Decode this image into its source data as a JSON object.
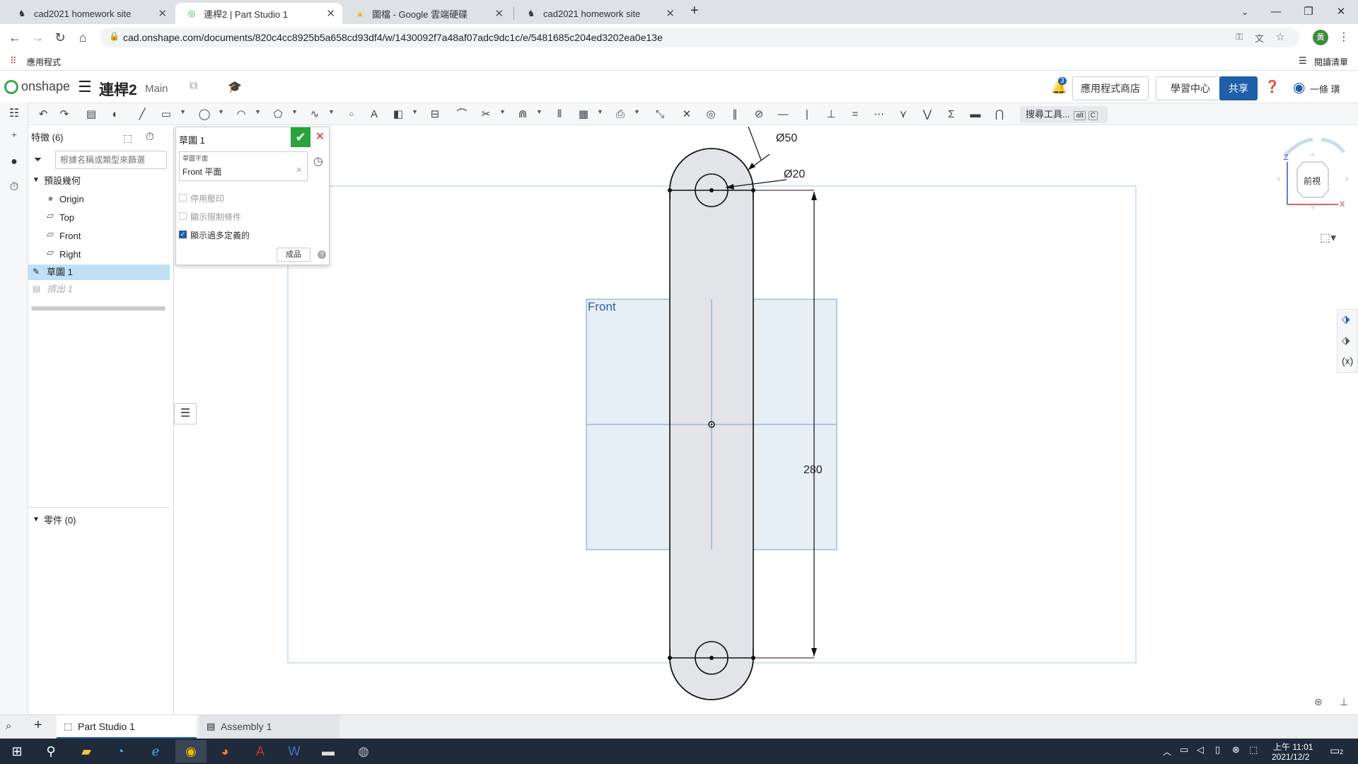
{
  "browser": {
    "tabs": [
      {
        "title": "cad2021 homework site"
      },
      {
        "title": "連桿2 | Part Studio 1"
      },
      {
        "title": "圖檔 - Google 雲端硬碟"
      },
      {
        "title": "cad2021 homework site"
      }
    ],
    "url": "cad.onshape.com/documents/820c4cc8925b5a658cd93df4/w/1430092f7a48af07adc9dc1c/e/5481685c204ed3202ea0e13e",
    "bookmarks_apps": "應用程式",
    "reading_list": "閱讀清單",
    "profile_initial": "黃"
  },
  "onshape": {
    "brand": "onshape",
    "doc_title": "連桿2",
    "branch": "Main",
    "notifications": "3",
    "app_store": "應用程式商店",
    "learning": "學習中心",
    "share": "共享",
    "user": "一條 璜",
    "search_tools": "搜尋工具...",
    "shortcut_alt": "alt",
    "shortcut_c": "C"
  },
  "feature_panel": {
    "header": "特徵 (6)",
    "filter_placeholder": "根據名稱或類型來篩選",
    "default_geometry": "預設幾何",
    "items": [
      "Origin",
      "Top",
      "Front",
      "Right"
    ],
    "sketch1": "草圖 1",
    "extrude1": "擠出 1",
    "parts": "零件 (0)"
  },
  "sketch_dialog": {
    "title": "草圖 1",
    "plane_label": "草圖平面",
    "plane_value": "Front 平面",
    "opt_disable_imprint": "停用壓印",
    "opt_show_constraints": "顯示限制條件",
    "opt_show_overdefined": "顯示過多定義的",
    "finish_btn": "成品"
  },
  "canvas": {
    "plane_name": "Front",
    "dim_outer": "Ø50",
    "dim_inner": "Ø20",
    "dim_length": "280",
    "view_cube_label": "前視",
    "axis_z": "Z",
    "axis_x": "X"
  },
  "bottom_tabs": [
    {
      "label": "Part Studio 1"
    },
    {
      "label": "Assembly 1"
    }
  ],
  "taskbar": {
    "time": "上午 11:01",
    "date": "2021/12/2",
    "notify_count": "2"
  },
  "colors": {
    "onshape_green": "#3da84a",
    "share_blue": "#1f5ea8",
    "selected_row": "#bfe0f5",
    "plane_fill": "#e6eef6",
    "sketch_fill": "#e4e6ea"
  }
}
